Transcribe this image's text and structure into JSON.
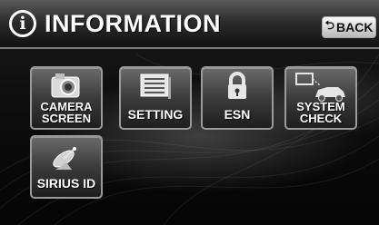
{
  "header": {
    "title": "INFORMATION",
    "back_label": "BACK"
  },
  "icons": {
    "info": "info-circle-icon",
    "back": "return-arrow-icon"
  },
  "tiles": [
    {
      "label": "CAMERA\nSCREEN",
      "icon": "camera-icon"
    },
    {
      "label": "SETTING",
      "icon": "settings-list-icon"
    },
    {
      "label": "ESN",
      "icon": "lock-icon"
    },
    {
      "label": "SYSTEM\nCHECK",
      "icon": "car-system-icon"
    },
    {
      "label": "SIRIUS ID",
      "icon": "satellite-dish-icon"
    }
  ],
  "colors": {
    "header_top": "#5a5a5a",
    "tile_border": "#9a9a9a",
    "text": "#ffffff"
  }
}
